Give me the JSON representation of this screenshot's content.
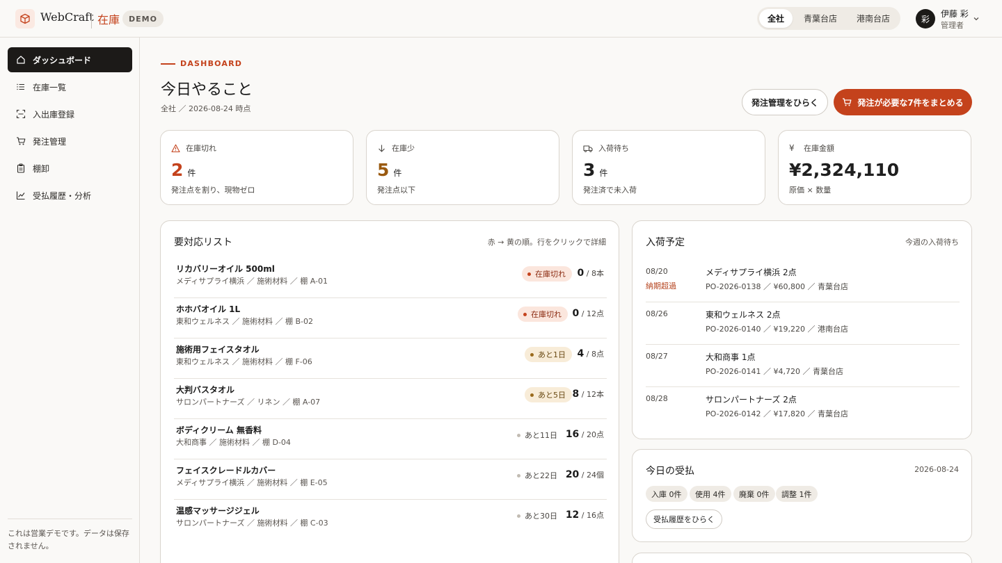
{
  "header": {
    "brand": "WebCraft",
    "brand_sub": "在庫",
    "demo_badge": "DEMO",
    "stores": [
      "全社",
      "青葉台店",
      "港南台店"
    ],
    "user_initial": "彩",
    "user_name": "伊藤 彩",
    "user_role": "管理者"
  },
  "sidebar": {
    "items": [
      {
        "label": "ダッシュボード",
        "icon": "home-icon"
      },
      {
        "label": "在庫一覧",
        "icon": "list-icon"
      },
      {
        "label": "入出庫登録",
        "icon": "scan-icon"
      },
      {
        "label": "発注管理",
        "icon": "cart-icon"
      },
      {
        "label": "棚卸",
        "icon": "clipboard-icon"
      },
      {
        "label": "受払履歴・分析",
        "icon": "chart-icon"
      }
    ],
    "note": "これは営業デモです。データは保存されません。"
  },
  "main": {
    "eyebrow": "DASHBOARD",
    "title": "今日やること",
    "subtitle": "全社 ／ 2026-08-24 時点",
    "btn_secondary": "発注管理をひらく",
    "btn_primary": "発注が必要な7件をまとめる"
  },
  "kpis": [
    {
      "label": "在庫切れ",
      "icon": "warning-icon",
      "value": "2",
      "unit": "件",
      "note": "発注点を割り、現物ゼロ",
      "color": "#c4421c"
    },
    {
      "label": "在庫少",
      "icon": "arrow-down-icon",
      "value": "5",
      "unit": "件",
      "note": "発注点以下",
      "color": "#9a5a10"
    },
    {
      "label": "入荷待ち",
      "icon": "truck-icon",
      "value": "3",
      "unit": "件",
      "note": "発注済で未入荷",
      "color": "#1a1a1a"
    },
    {
      "label": "在庫金額",
      "icon": "yen-icon",
      "value": "¥2,324,110",
      "unit": "",
      "note": "原価 × 数量",
      "color": "#1a1a1a"
    }
  ],
  "tasks": {
    "title": "要対応リスト",
    "hint": "赤 → 黄の順。行をクリックで詳細",
    "rows": [
      {
        "name": "リカバリーオイル 500ml",
        "meta": "メディサプライ横浜 ／ 施術材料 ／ 棚 A-01",
        "badge": "在庫切れ",
        "qty": "0",
        "total": " / 8本"
      },
      {
        "name": "ホホバオイル 1L",
        "meta": "東和ウェルネス ／ 施術材料 ／ 棚 B-02",
        "badge": "在庫切れ",
        "qty": "0",
        "total": " / 12点"
      },
      {
        "name": "施術用フェイスタオル",
        "meta": "東和ウェルネス ／ 施術材料 ／ 棚 F-06",
        "badge": "あと1日",
        "qty": "4",
        "total": " / 8点"
      },
      {
        "name": "大判バスタオル",
        "meta": "サロンパートナーズ ／ リネン ／ 棚 A-07",
        "badge": "あと5日",
        "qty": "8",
        "total": " / 12本"
      },
      {
        "name": "ボディクリーム 無香料",
        "meta": "大和商事 ／ 施術材料 ／ 棚 D-04",
        "badge": "あと11日",
        "qty": "16",
        "total": " / 20点"
      },
      {
        "name": "フェイスクレードルカバー",
        "meta": "メディサプライ横浜 ／ 施術材料 ／ 棚 E-05",
        "badge": "あと22日",
        "qty": "20",
        "total": " / 24個"
      },
      {
        "name": "温感マッサージジェル",
        "meta": "サロンパートナーズ ／ 施術材料 ／ 棚 C-03",
        "badge": "あと30日",
        "qty": "12",
        "total": " / 16点"
      }
    ]
  },
  "arrivals": {
    "title": "入荷予定",
    "hint": "今週の入荷待ち",
    "rows": [
      {
        "date": "08/20",
        "late": "納期超過",
        "title": "メディサプライ横浜 2点",
        "meta": "PO-2026-0138 ／ ¥60,800 ／ 青葉台店"
      },
      {
        "date": "08/26",
        "late": "",
        "title": "東和ウェルネス 2点",
        "meta": "PO-2026-0140 ／ ¥19,220 ／ 港南台店"
      },
      {
        "date": "08/27",
        "late": "",
        "title": "大和商事 1点",
        "meta": "PO-2026-0141 ／ ¥4,720 ／ 青葉台店"
      },
      {
        "date": "08/28",
        "late": "",
        "title": "サロンパートナーズ 2点",
        "meta": "PO-2026-0142 ／ ¥17,820 ／ 青葉台店"
      }
    ]
  },
  "flow": {
    "title": "今日の受払",
    "date": "2026-08-24",
    "chips": [
      "入庫 0件",
      "使用 4件",
      "廃棄 0件",
      "調整 1件"
    ],
    "button": "受払履歴をひらく"
  }
}
